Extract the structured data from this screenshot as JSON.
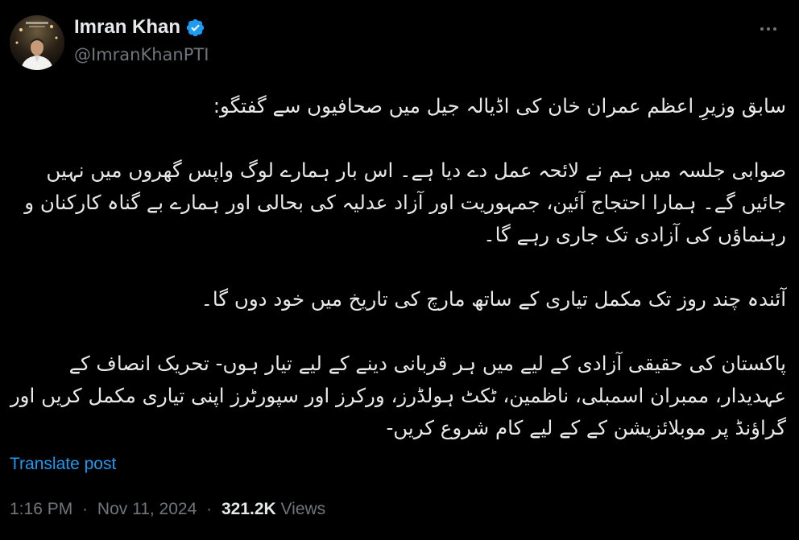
{
  "author": {
    "name": "Imran Khan",
    "handle": "@ImranKhanPTI",
    "verified_icon": "verified-badge-icon",
    "verified_color": "#1d9bf0"
  },
  "more_icon": "more-dots-icon",
  "tweet": {
    "paragraphs": [
      "سابق وزیرِ اعظم عمران خان کی اڈیالہ جیل میں صحافیوں سے گفتگو:",
      "صوابی جلسہ میں ہم نے لائحہ عمل دے دیا ہے۔ اس بار ہمارے لوگ واپس گھروں میں نہیں جائیں گے۔ ہمارا احتجاج آئین، جمہوریت اور آزاد عدلیہ کی بحالی اور ہمارے بے گناہ کارکنان و رہنماؤں کی آزادی تک جاری رہے گا۔",
      "آئندہ چند روز تک مکمل تیاری کے ساتھ مارچ کی تاریخ میں خود دوں گا۔",
      "پاکستان کی حقیقی آزادی کے لیے میں ہر قربانی دینے کے لیے تیار ہوں- تحریک انصاف کے عہدیدار، ممبران اسمبلی، ناظمین، ٹکٹ ہولڈرز، ورکرز اور سپورٹرز اپنی تیاری مکمل کریں اور گراؤنڈ پر موبلائزیشن کے کے لیے کام شروع کریں-"
    ],
    "translate_label": "Translate post"
  },
  "meta": {
    "time": "1:16 PM",
    "separator": "·",
    "date": "Nov 11, 2024",
    "views_count": "321.2K",
    "views_label": "Views"
  },
  "colors": {
    "background": "#000000",
    "text": "#e7e9ea",
    "secondary": "#71767b",
    "accent": "#1d9bf0"
  }
}
